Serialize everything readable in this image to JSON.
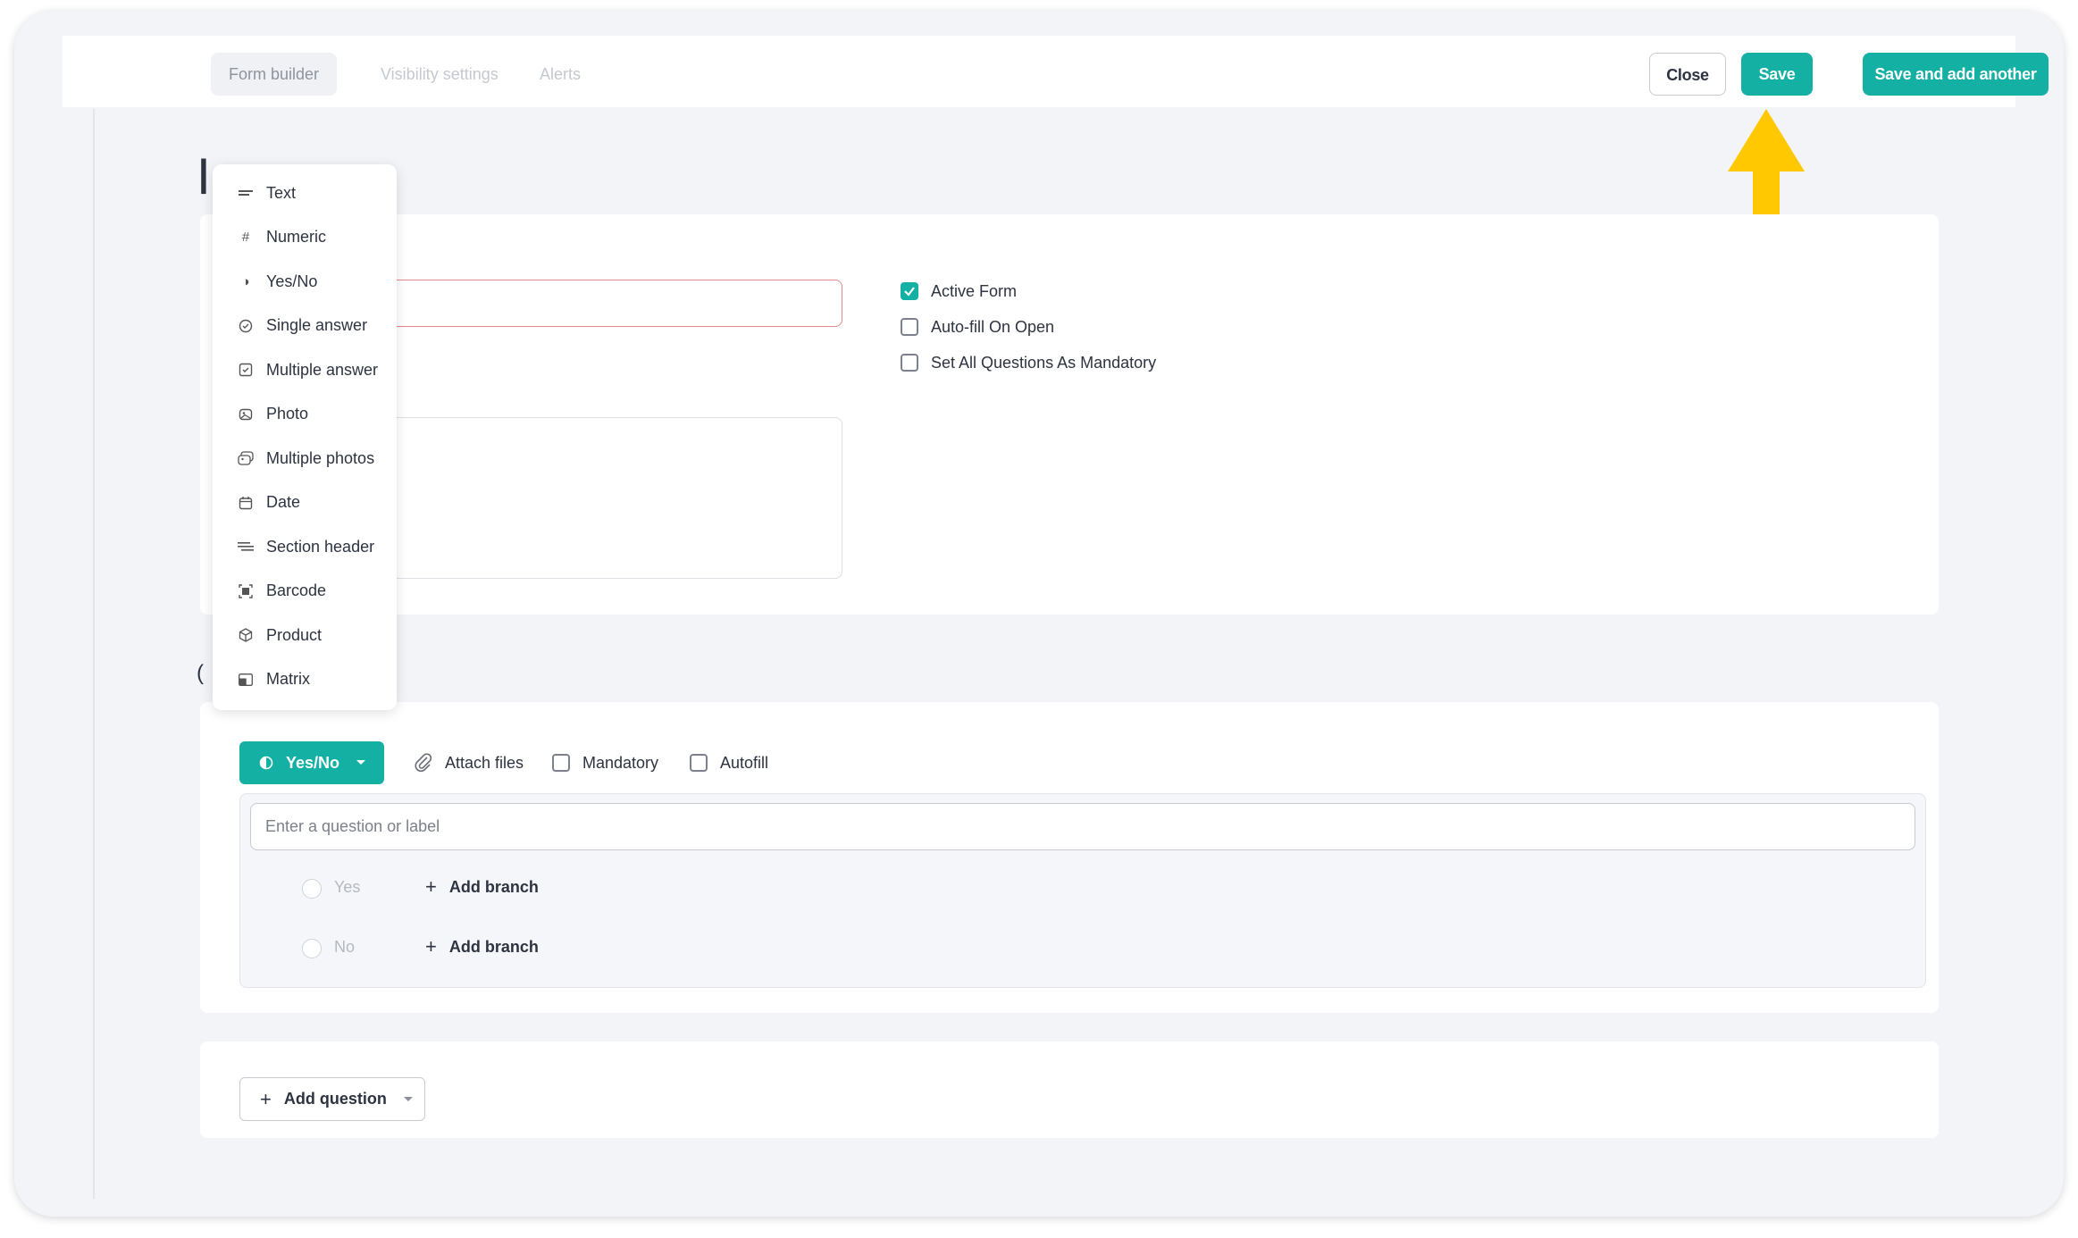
{
  "tabs": [
    {
      "label": "Form builder",
      "active": true
    },
    {
      "label": "Visibility settings",
      "active": false
    },
    {
      "label": "Alerts",
      "active": false
    }
  ],
  "actions": {
    "close_label": "Close",
    "save_label": "Save",
    "save_add_label": "Save and add another"
  },
  "settings": {
    "active_form": {
      "label": "Active Form",
      "checked": true
    },
    "auto_fill": {
      "label": "Auto-fill On Open",
      "checked": false
    },
    "all_mandatory": {
      "label": "Set All Questions As Mandatory",
      "checked": false
    }
  },
  "type_menu": {
    "items": [
      {
        "label": "Text",
        "icon": "text-icon"
      },
      {
        "label": "Numeric",
        "icon": "hash-icon"
      },
      {
        "label": "Yes/No",
        "icon": "half-circle-icon"
      },
      {
        "label": "Single answer",
        "icon": "check-circle-icon"
      },
      {
        "label": "Multiple answer",
        "icon": "check-square-icon"
      },
      {
        "label": "Photo",
        "icon": "photo-icon"
      },
      {
        "label": "Multiple photos",
        "icon": "photos-icon"
      },
      {
        "label": "Date",
        "icon": "calendar-icon"
      },
      {
        "label": "Section header",
        "icon": "section-header-icon"
      },
      {
        "label": "Barcode",
        "icon": "barcode-icon"
      },
      {
        "label": "Product",
        "icon": "product-box-icon"
      },
      {
        "label": "Matrix",
        "icon": "matrix-icon"
      }
    ]
  },
  "question": {
    "type_label": "Yes/No",
    "attach_label": "Attach files",
    "mandatory_label": "Mandatory",
    "autofill_label": "Autofill",
    "placeholder": "Enter a question or label",
    "options": [
      {
        "label": "Yes",
        "branch_label": "Add branch"
      },
      {
        "label": "No",
        "branch_label": "Add branch"
      }
    ]
  },
  "add_question_label": "Add question",
  "colors": {
    "accent": "#14b0a3",
    "arrow": "#ffc800",
    "error_border": "#e8878a"
  }
}
